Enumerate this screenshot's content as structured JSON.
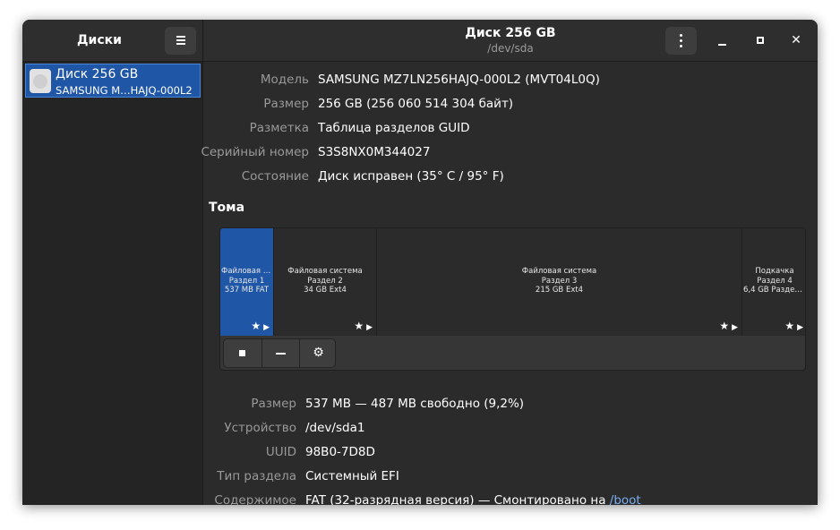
{
  "sidebar": {
    "app_title": "Диски",
    "disks": [
      {
        "name": "Диск 256 GB",
        "model": "SAMSUNG M…HAJQ-000L2"
      }
    ]
  },
  "header": {
    "title": "Диск 256 GB",
    "subtitle": "/dev/sda",
    "close_glyph": "✕"
  },
  "disk_props": [
    {
      "label": "Модель",
      "value": "SAMSUNG MZ7LN256HAJQ-000L2 (MVT04L0Q)"
    },
    {
      "label": "Размер",
      "value": "256 GB (256 060 514 304 байт)"
    },
    {
      "label": "Разметка",
      "value": "Таблица разделов GUID"
    },
    {
      "label": "Серийный номер",
      "value": "S3S8NX0M344027"
    },
    {
      "label": "Состояние",
      "value": "Диск исправен (35° C / 95° F)"
    }
  ],
  "volumes": {
    "title": "Тома",
    "partitions": [
      {
        "line1": "Файловая с…",
        "line2": "Раздел 1",
        "line3": "537 MB FAT",
        "selected": true
      },
      {
        "line1": "Файловая система",
        "line2": "Раздел 2",
        "line3": "34 GB Ext4",
        "selected": false
      },
      {
        "line1": "Файловая система",
        "line2": "Раздел 3",
        "line3": "215 GB Ext4",
        "selected": false
      },
      {
        "line1": "Подкачка",
        "line2": "Раздел 4",
        "line3": "6,4 GB Раздел…",
        "selected": false
      }
    ],
    "icons": {
      "star": "★",
      "play": "▶",
      "gears": "⚙"
    }
  },
  "partition_props": [
    {
      "label": "Размер",
      "value": "537 MB — 487 MB свободно (9,2%)"
    },
    {
      "label": "Устройство",
      "value": "/dev/sda1"
    },
    {
      "label": "UUID",
      "value": "98B0-7D8D"
    },
    {
      "label": "Тип раздела",
      "value": "Системный EFI"
    },
    {
      "label": "Содержимое",
      "value": "FAT (32-разрядная версия) — Смонтировано на ",
      "link": "/boot"
    }
  ],
  "colors": {
    "window_bg": "#2b2b2b",
    "sidebar_bg": "#242424",
    "accent": "#1f56a6",
    "link": "#78aeed",
    "label": "#999999"
  }
}
